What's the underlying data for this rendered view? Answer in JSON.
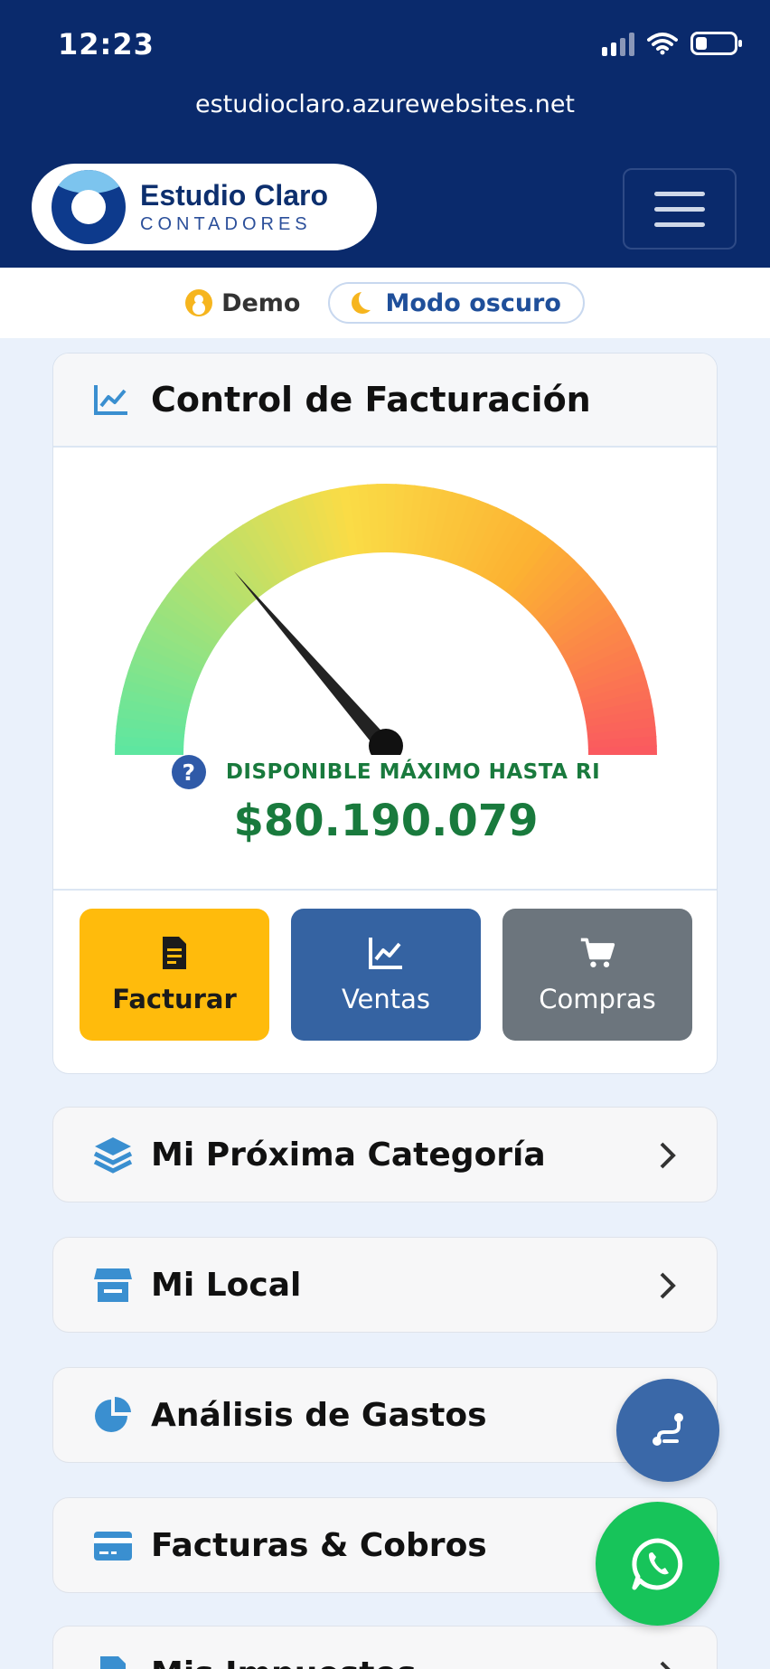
{
  "status": {
    "time": "12:23"
  },
  "browser": {
    "url": "estudioclaro.azurewebsites.net"
  },
  "brand": {
    "name": "Estudio Claro",
    "subtitle": "CONTADORES"
  },
  "user": {
    "name": "Demo",
    "dark_mode_label": "Modo oscuro"
  },
  "billing": {
    "title": "Control de Facturación",
    "gauge_level_percent": 28,
    "available_label": "DISPONIBLE MÁXIMO HASTA RI",
    "available_amount": "$80.190.079",
    "actions": [
      {
        "label": "Facturar",
        "icon": "invoice-icon"
      },
      {
        "label": "Ventas",
        "icon": "line-chart-icon"
      },
      {
        "label": "Compras",
        "icon": "cart-icon"
      }
    ]
  },
  "menu": [
    {
      "label": "Mi Próxima Categoría",
      "icon": "layers-icon"
    },
    {
      "label": "Mi Local",
      "icon": "store-icon"
    },
    {
      "label": "Análisis de Gastos",
      "icon": "pie-chart-icon"
    },
    {
      "label": "Facturas & Cobros",
      "icon": "credit-card-icon"
    },
    {
      "label": "Mis Impuestos",
      "icon": "file-icon"
    }
  ],
  "colors": {
    "header": "#0a2a6c",
    "accent_yellow": "#ffbb0c",
    "accent_blue": "#3563a2",
    "success_green": "#197a3d",
    "whatsapp": "#17c45a"
  }
}
